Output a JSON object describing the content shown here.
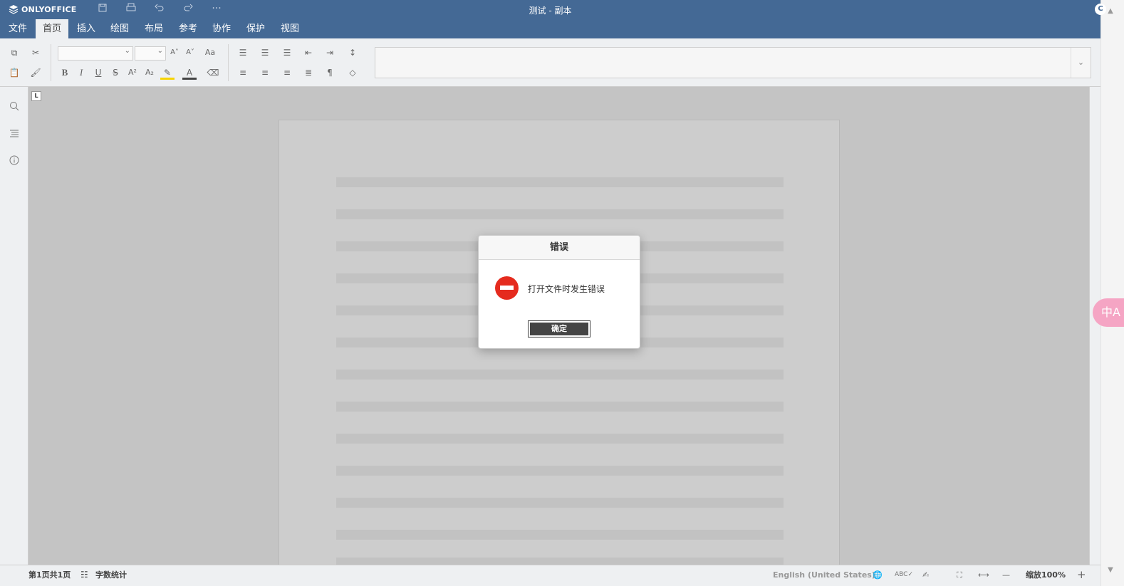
{
  "app": {
    "brand": "ONLYOFFICE",
    "doc_title": "测试 - 副本",
    "avatar_initial": "C"
  },
  "title_icons": [
    "save-icon",
    "print-icon",
    "undo-icon",
    "redo-icon",
    "more-icon"
  ],
  "more_label": "···",
  "menu": {
    "tabs": [
      "文件",
      "首页",
      "插入",
      "绘图",
      "布局",
      "参考",
      "协作",
      "保护",
      "视图"
    ],
    "active": "首页"
  },
  "toolbar": {
    "font_name": "",
    "font_size": "",
    "bold": "B",
    "italic": "I",
    "underline": "U",
    "strike": "S",
    "superscript": "A²",
    "subscript": "A₂",
    "grow_font": "A˄",
    "shrink_font": "A˅",
    "change_case": "Aa",
    "pilcrow": "¶"
  },
  "status": {
    "page_info": "第1页共1页",
    "word_count": "字数统计",
    "language": "English (United States)",
    "zoom": "缩放100%",
    "zoom_minus": "—",
    "zoom_plus": "+"
  },
  "dialog": {
    "title": "错误",
    "message": "打开文件时发生错误",
    "ok_button": "确定"
  },
  "colors": {
    "header": "#446995",
    "error": "#e52b1e"
  },
  "translate_fab": "中A"
}
